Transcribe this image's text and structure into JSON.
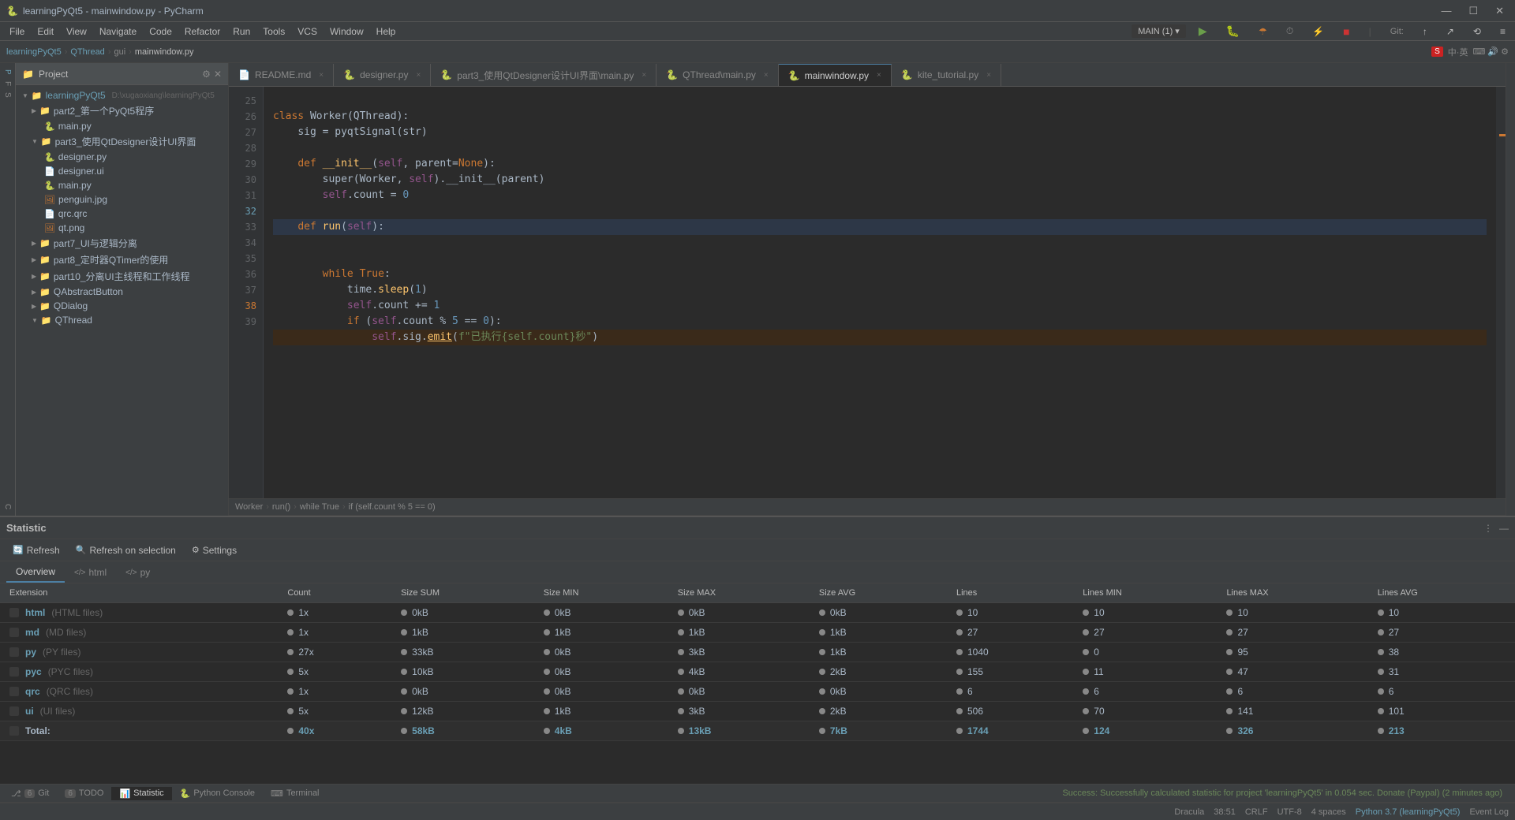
{
  "titlebar": {
    "title": "learningPyQt5 - mainwindow.py - PyCharm",
    "icon": "🐍",
    "controls": [
      "—",
      "☐",
      "✕"
    ]
  },
  "menubar": {
    "items": [
      "File",
      "Edit",
      "View",
      "Navigate",
      "Code",
      "Refactor",
      "Run",
      "Tools",
      "VCS",
      "Window",
      "Help"
    ]
  },
  "toolbar": {
    "project_name": "MAIN (1)",
    "breadcrumb": [
      "learningPyQt5",
      "QThread",
      "gui",
      "mainwindow.py"
    ]
  },
  "tabs": [
    {
      "label": "README.md",
      "active": false,
      "icon": "📄"
    },
    {
      "label": "designer.py",
      "active": false,
      "icon": "🐍"
    },
    {
      "label": "part3_使用QtDesigner设计UI界面\\main.py",
      "active": false,
      "icon": "🐍"
    },
    {
      "label": "QThread\\main.py",
      "active": false,
      "icon": "🐍"
    },
    {
      "label": "mainwindow.py",
      "active": true,
      "icon": "🐍"
    },
    {
      "label": "kite_tutorial.py",
      "active": false,
      "icon": "🐍"
    }
  ],
  "breadcrumb_path": [
    "Worker",
    "run()",
    "while True",
    "if (self.count % 5 == 0)"
  ],
  "line_numbers": [
    25,
    26,
    27,
    28,
    29,
    30,
    31,
    32,
    33,
    34,
    35,
    36,
    37,
    38,
    39
  ],
  "code_lines": [
    "class Worker(QThread):",
    "    sig = pyqtSignal(str)",
    "",
    "    def __init__(self, parent=None):",
    "        super(Worker, self).__init__(parent)",
    "        self.count = 0",
    "",
    "    def run(self):",
    "",
    "        while True:",
    "            time.sleep(1)",
    "            self.count += 1",
    "            if (self.count % 5 == 0):",
    "                self.sig.emit(f\"已执行{self.count}秒\")",
    ""
  ],
  "project": {
    "title": "Project",
    "root": "learningPyQt5",
    "root_path": "D:\\xugaoxiang\\learningPyQt5",
    "items": [
      {
        "label": "part2_第一个PyQt5程序",
        "type": "folder",
        "indent": 1
      },
      {
        "label": "main.py",
        "type": "py",
        "indent": 2
      },
      {
        "label": "part3_使用QtDesigner设计UI界面",
        "type": "folder",
        "indent": 1
      },
      {
        "label": "designer.py",
        "type": "py",
        "indent": 2
      },
      {
        "label": "designer.ui",
        "type": "ui",
        "indent": 2
      },
      {
        "label": "main.py",
        "type": "py",
        "indent": 2
      },
      {
        "label": "penguin.jpg",
        "type": "img",
        "indent": 2
      },
      {
        "label": "qrc.qrc",
        "type": "qrc",
        "indent": 2
      },
      {
        "label": "qt.png",
        "type": "img",
        "indent": 2
      },
      {
        "label": "part7_UI与逻辑分离",
        "type": "folder",
        "indent": 1
      },
      {
        "label": "part8_定时器QTimer的使用",
        "type": "folder",
        "indent": 1
      },
      {
        "label": "part10_分离UI主线程和工作线程",
        "type": "folder",
        "indent": 1
      },
      {
        "label": "QAbstractButton",
        "type": "folder",
        "indent": 1
      },
      {
        "label": "QDialog",
        "type": "folder",
        "indent": 1
      },
      {
        "label": "QThread",
        "type": "folder",
        "indent": 1,
        "expanded": true
      }
    ]
  },
  "statistic": {
    "panel_title": "Statistic",
    "toolbar": {
      "refresh": "Refresh",
      "refresh_on_selection": "Refresh on selection",
      "settings": "Settings"
    },
    "tabs": [
      "Overview",
      "html",
      "py"
    ],
    "active_tab": "Overview",
    "table": {
      "headers": [
        "Extension",
        "Count",
        "Size SUM",
        "Size MIN",
        "Size MAX",
        "Size AVG",
        "Lines",
        "Lines MIN",
        "Lines MAX",
        "Lines AVG"
      ],
      "rows": [
        {
          "ext": "html",
          "desc": "HTML files",
          "count": "1x",
          "size_sum": "0kB",
          "size_min": "0kB",
          "size_max": "0kB",
          "size_avg": "0kB",
          "lines": "10",
          "lines_min": "10",
          "lines_max": "10",
          "lines_avg": "10"
        },
        {
          "ext": "md",
          "desc": "MD files",
          "count": "1x",
          "size_sum": "1kB",
          "size_min": "1kB",
          "size_max": "1kB",
          "size_avg": "1kB",
          "lines": "27",
          "lines_min": "27",
          "lines_max": "27",
          "lines_avg": "27"
        },
        {
          "ext": "py",
          "desc": "PY files",
          "count": "27x",
          "size_sum": "33kB",
          "size_min": "0kB",
          "size_max": "3kB",
          "size_avg": "1kB",
          "lines": "1040",
          "lines_min": "0",
          "lines_max": "95",
          "lines_avg": "38"
        },
        {
          "ext": "pyc",
          "desc": "PYC files",
          "count": "5x",
          "size_sum": "10kB",
          "size_min": "0kB",
          "size_max": "4kB",
          "size_avg": "2kB",
          "lines": "155",
          "lines_min": "11",
          "lines_max": "47",
          "lines_avg": "31"
        },
        {
          "ext": "qrc",
          "desc": "QRC files",
          "count": "1x",
          "size_sum": "0kB",
          "size_min": "0kB",
          "size_max": "0kB",
          "size_avg": "0kB",
          "lines": "6",
          "lines_min": "6",
          "lines_max": "6",
          "lines_avg": "6"
        },
        {
          "ext": "ui",
          "desc": "UI files",
          "count": "5x",
          "size_sum": "12kB",
          "size_min": "1kB",
          "size_max": "3kB",
          "size_avg": "2kB",
          "lines": "506",
          "lines_min": "70",
          "lines_max": "141",
          "lines_avg": "101"
        },
        {
          "ext": "Total:",
          "desc": "",
          "count": "40x",
          "size_sum": "58kB",
          "size_min": "4kB",
          "size_max": "13kB",
          "size_avg": "7kB",
          "lines": "1744",
          "lines_min": "124",
          "lines_max": "326",
          "lines_avg": "213",
          "is_total": true
        }
      ]
    }
  },
  "status_bar": {
    "git": "Git",
    "git_num": "6",
    "todo": "TODO",
    "todo_num": "6",
    "statistic": "Statistic",
    "python_console": "Python Console",
    "terminal": "Terminal",
    "success_msg": "Success: Successfully calculated statistic for project 'learningPyQt5' in 0.054 sec. Donate (Paypal) (2 minutes ago)",
    "theme": "Dracula",
    "line_col": "38:51",
    "crlf": "CRLF",
    "encoding": "UTF-8",
    "indent": "4 spaces",
    "python_version": "Python 3.7 (learningPyQt5)",
    "event_log": "Event Log"
  }
}
